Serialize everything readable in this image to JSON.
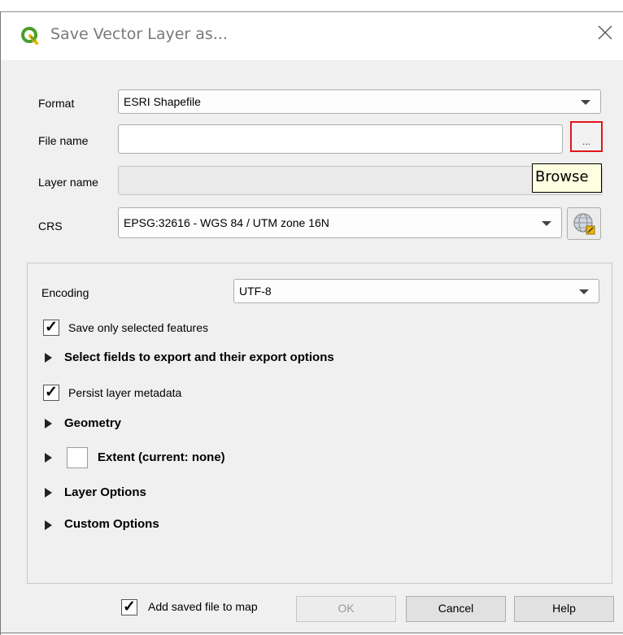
{
  "window": {
    "title": "Save Vector Layer as...",
    "close_icon": "close-icon",
    "app_icon": "qgis-logo-icon"
  },
  "form": {
    "format_label": "Format",
    "format_value": "ESRI Shapefile",
    "filename_label": "File name",
    "filename_value": "",
    "browse_button": "...",
    "browse_tooltip": "Browse",
    "layername_label": "Layer name",
    "layername_value": "",
    "crs_label": "CRS",
    "crs_value": "EPSG:32616 - WGS 84 / UTM zone 16N",
    "crs_select_icon": "globe-select-icon"
  },
  "options": {
    "encoding_label": "Encoding",
    "encoding_value": "UTF-8",
    "save_selected_label": "Save only selected features",
    "save_selected_checked": true,
    "select_fields_label": "Select fields to export and their export options",
    "persist_metadata_label": "Persist layer metadata",
    "persist_metadata_checked": true,
    "geometry_label": "Geometry",
    "extent_label": "Extent (current: none)",
    "extent_checked": false,
    "layer_options_label": "Layer Options",
    "custom_options_label": "Custom Options"
  },
  "footer": {
    "add_to_map_label": "Add saved file to map",
    "add_to_map_checked": true,
    "ok_label": "OK",
    "cancel_label": "Cancel",
    "help_label": "Help"
  },
  "colors": {
    "highlight_border": "#e3141b",
    "tooltip_bg": "#ffffe1",
    "dialog_bg": "#f0f0f0"
  }
}
